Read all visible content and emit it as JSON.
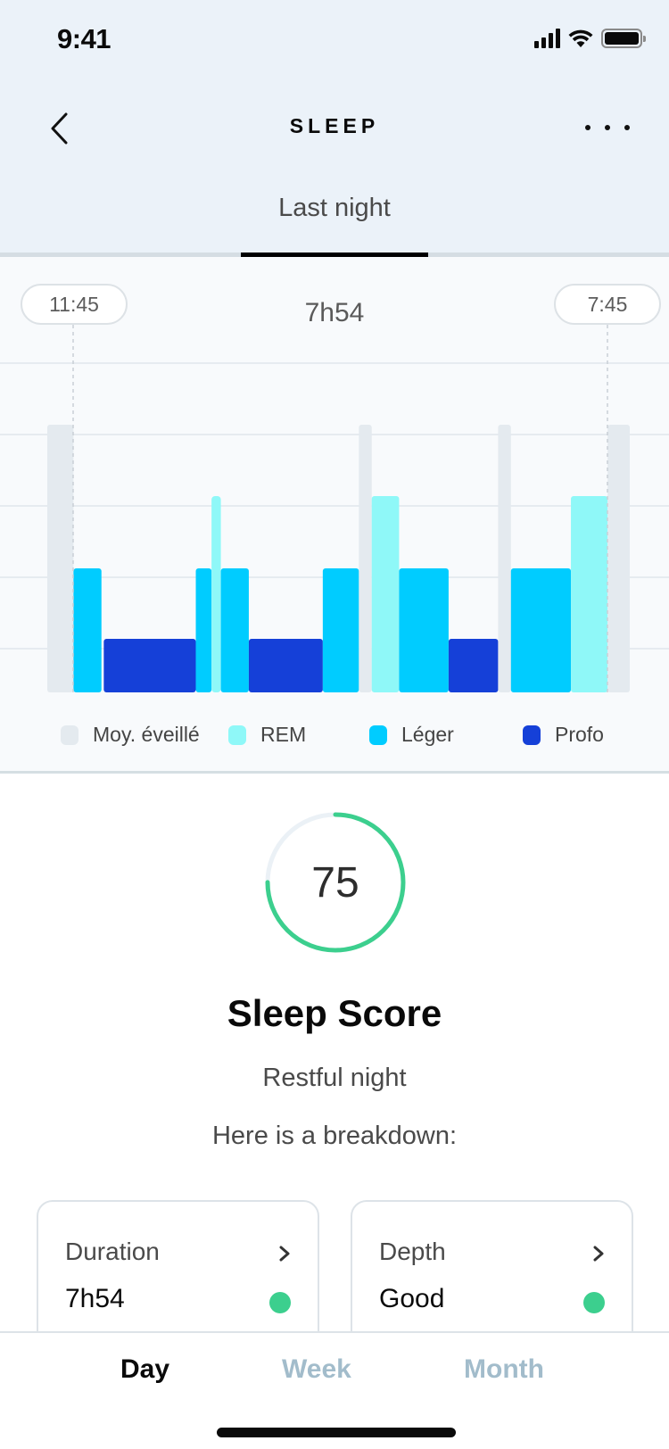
{
  "status_bar": {
    "time": "9:41",
    "icons": [
      "cellular-signal-icon",
      "wifi-icon",
      "battery-icon"
    ]
  },
  "nav": {
    "back_icon": "chevron-left-icon",
    "title": "SLEEP",
    "more_icon": "more-horizontal-icon"
  },
  "tabs": [
    {
      "label": "Last night",
      "active": true
    }
  ],
  "chart": {
    "start_time": "11:45",
    "end_time": "7:45",
    "total_duration": "7h54"
  },
  "chart_data": {
    "type": "bar",
    "subtype": "hypnogram",
    "title": "",
    "xlabel": "",
    "ylabel": "",
    "x_range_labels": [
      "11:45",
      "7:45"
    ],
    "grid": true,
    "stage_levels": {
      "Moy. éveillé": 4,
      "REM": 3,
      "Léger": 2,
      "Profo": 1
    },
    "segments": [
      {
        "stage": "Moy. éveillé",
        "start": 0.0,
        "end": 0.045
      },
      {
        "stage": "Léger",
        "start": 0.045,
        "end": 0.093
      },
      {
        "stage": "Profo",
        "start": 0.097,
        "end": 0.255
      },
      {
        "stage": "Léger",
        "start": 0.255,
        "end": 0.282
      },
      {
        "stage": "REM",
        "start": 0.282,
        "end": 0.298
      },
      {
        "stage": "Léger",
        "start": 0.298,
        "end": 0.346
      },
      {
        "stage": "Profo",
        "start": 0.346,
        "end": 0.473
      },
      {
        "stage": "Léger",
        "start": 0.473,
        "end": 0.535
      },
      {
        "stage": "Moy. éveillé",
        "start": 0.535,
        "end": 0.557
      },
      {
        "stage": "REM",
        "start": 0.557,
        "end": 0.604
      },
      {
        "stage": "Léger",
        "start": 0.604,
        "end": 0.689
      },
      {
        "stage": "Profo",
        "start": 0.689,
        "end": 0.774
      },
      {
        "stage": "Moy. éveillé",
        "start": 0.774,
        "end": 0.796
      },
      {
        "stage": "Léger",
        "start": 0.796,
        "end": 0.899
      },
      {
        "stage": "REM",
        "start": 0.899,
        "end": 0.962
      },
      {
        "stage": "Moy. éveillé",
        "start": 0.962,
        "end": 1.0
      }
    ],
    "legend": [
      {
        "label": "Moy. éveillé",
        "color": "#e4eaef"
      },
      {
        "label": "REM",
        "color": "#8ff8f8"
      },
      {
        "label": "Léger",
        "color": "#00ccff"
      },
      {
        "label": "Profo",
        "color": "#1540d8"
      }
    ],
    "legend_position": "bottom"
  },
  "score": {
    "value": "75",
    "progress_percent": 75,
    "ring_color": "#3ccf8e",
    "track_color": "#ebf1f6",
    "title": "Sleep Score",
    "subtitle": "Restful night",
    "intro": "Here is a breakdown:"
  },
  "breakdown_cards": [
    {
      "label": "Duration",
      "value": "7h54",
      "status_color": "#3ccf8e"
    },
    {
      "label": "Depth",
      "value": "Good",
      "status_color": "#3ccf8e"
    }
  ],
  "period_tabs": [
    {
      "label": "Day",
      "active": true
    },
    {
      "label": "Week",
      "active": false
    },
    {
      "label": "Month",
      "active": false
    }
  ]
}
